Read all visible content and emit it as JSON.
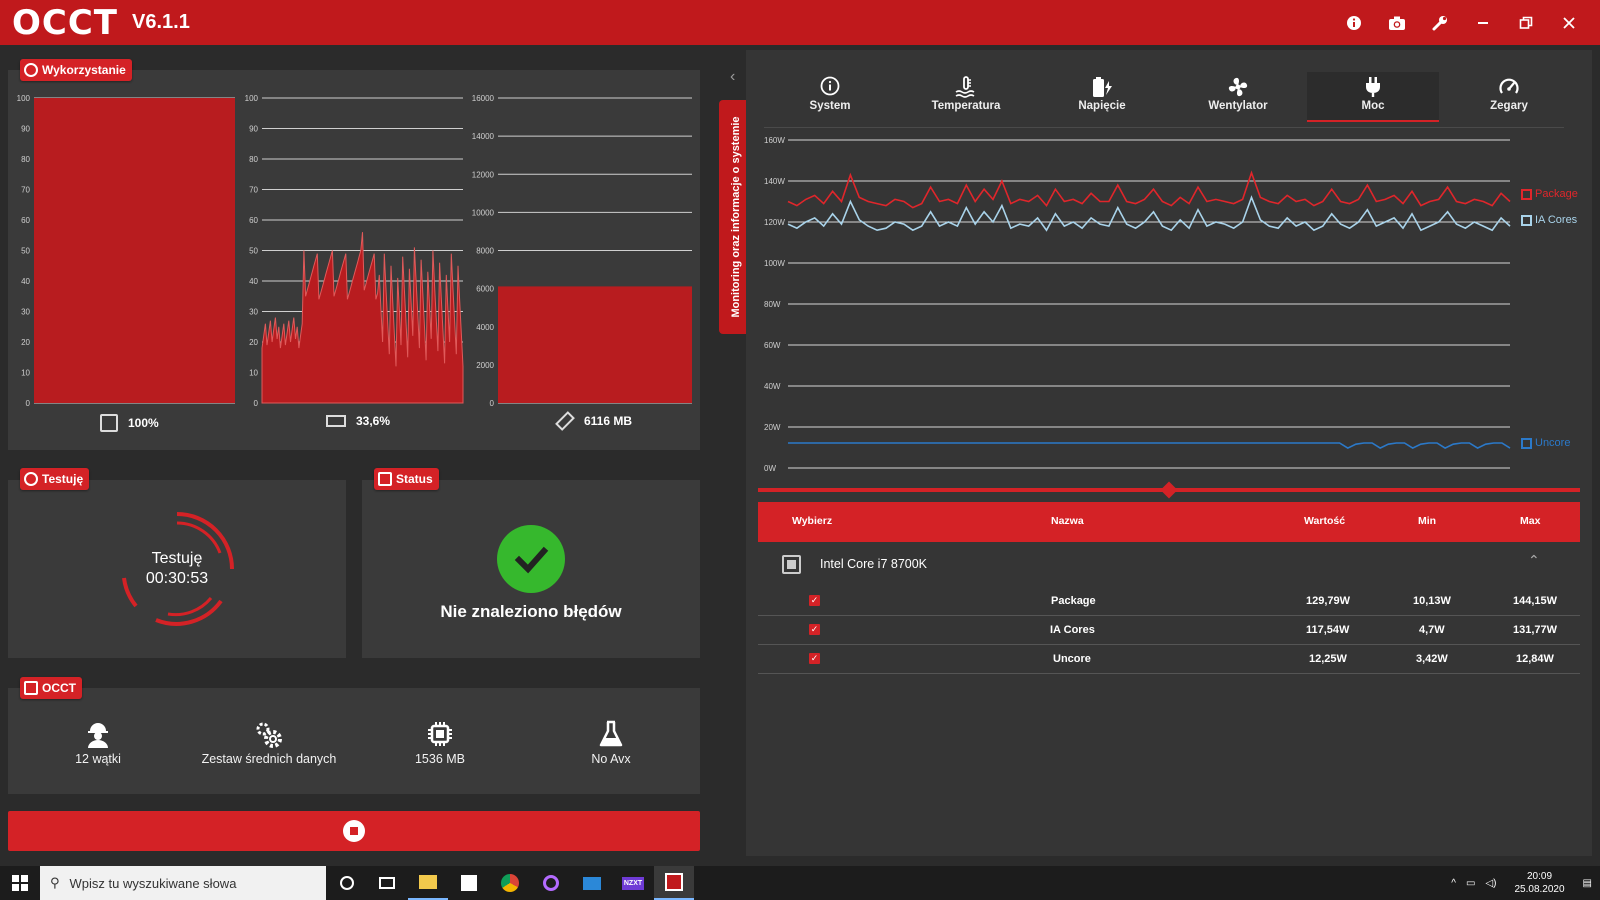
{
  "app": {
    "logo": "OCCT",
    "version": "V6.1.1",
    "title_icons": [
      "info-icon",
      "camera-icon",
      "wrench-icon",
      "minimize-icon",
      "restore-icon",
      "close-icon"
    ]
  },
  "usage": {
    "badge": "Wykorzystanie",
    "cpu_label": "100%",
    "gpu_label": "33,6%",
    "ram_label": "6116 MB",
    "cpu_axis": [
      "100",
      "90",
      "80",
      "70",
      "60",
      "50",
      "40",
      "30",
      "20",
      "10",
      "0"
    ],
    "gpu_axis": [
      "100",
      "90",
      "80",
      "70",
      "60",
      "50",
      "40",
      "30",
      "20",
      "10",
      "0"
    ],
    "ram_axis": [
      "16000",
      "14000",
      "12000",
      "10000",
      "8000",
      "6000",
      "4000",
      "2000",
      "0"
    ]
  },
  "testing": {
    "badge": "Testuję",
    "state": "Testuję",
    "elapsed": "00:30:53"
  },
  "status": {
    "badge": "Status",
    "message": "Nie znaleziono błędów"
  },
  "occt_settings": {
    "badge": "OCCT",
    "items": [
      {
        "icon": "worker-icon",
        "label": "12 wątki"
      },
      {
        "icon": "gears-icon",
        "label": "Zestaw średnich danych"
      },
      {
        "icon": "chip-icon",
        "label": "1536 MB"
      },
      {
        "icon": "flask-icon",
        "label": "No Avx"
      }
    ]
  },
  "side_tab": {
    "label": "Monitoring oraz informacje o systemie"
  },
  "tabs": [
    {
      "label": "System",
      "icon": "info-icon"
    },
    {
      "label": "Temperatura",
      "icon": "thermometer-icon"
    },
    {
      "label": "Napięcie",
      "icon": "battery-bolt-icon"
    },
    {
      "label": "Wentylator",
      "icon": "fan-icon"
    },
    {
      "label": "Moc",
      "icon": "plug-icon",
      "active": true
    },
    {
      "label": "Zegary",
      "icon": "gauge-icon"
    }
  ],
  "chart_data": {
    "type": "line",
    "y_ticks": [
      "160W",
      "140W",
      "120W",
      "100W",
      "80W",
      "60W",
      "40W",
      "20W",
      "0W"
    ],
    "ylim": [
      0,
      160
    ],
    "grid": true,
    "legend_position": "right",
    "series": [
      {
        "name": "Package",
        "color": "#e0262b",
        "values": [
          130,
          128,
          131,
          133,
          129,
          135,
          130,
          143,
          132,
          130,
          129,
          128,
          131,
          130,
          127,
          129,
          137,
          130,
          131,
          129,
          138,
          130,
          136,
          131,
          140,
          129,
          131,
          130,
          133,
          128,
          136,
          130,
          131,
          129,
          134,
          130,
          130,
          138,
          130,
          129,
          131,
          136,
          130,
          128,
          132,
          129,
          137,
          130,
          131,
          130,
          129,
          131,
          144,
          132,
          130,
          129,
          133,
          130,
          131,
          128,
          130,
          136,
          130,
          129,
          131,
          138,
          130,
          131,
          133,
          129,
          135,
          128,
          130,
          131,
          137,
          130,
          129,
          131,
          130,
          128,
          134,
          130
        ]
      },
      {
        "name": "IA Cores",
        "color": "#a9d3ea",
        "values": [
          119,
          117,
          120,
          122,
          118,
          124,
          119,
          130,
          121,
          118,
          116,
          117,
          120,
          119,
          116,
          118,
          125,
          118,
          120,
          118,
          127,
          119,
          125,
          120,
          128,
          117,
          119,
          118,
          122,
          116,
          124,
          118,
          120,
          117,
          122,
          119,
          118,
          127,
          119,
          117,
          120,
          125,
          118,
          116,
          121,
          117,
          126,
          118,
          120,
          119,
          117,
          120,
          132,
          121,
          118,
          117,
          122,
          118,
          120,
          116,
          118,
          124,
          119,
          117,
          120,
          126,
          118,
          120,
          122,
          117,
          124,
          116,
          118,
          120,
          125,
          119,
          117,
          120,
          118,
          116,
          122,
          118
        ]
      },
      {
        "name": "Uncore",
        "color": "#2b79c9",
        "values": [
          12.2,
          12.2,
          12.2,
          12.2,
          12.2,
          12.2,
          12.2,
          12.2,
          12.2,
          12.2,
          12.2,
          12.2,
          12.2,
          12.2,
          12.2,
          12.2,
          12.2,
          12.2,
          12.2,
          12.2,
          12.2,
          12.2,
          12.2,
          12.2,
          12.2,
          12.2,
          12.2,
          12.2,
          12.2,
          12.2,
          12.2,
          12.2,
          12.2,
          12.2,
          12.2,
          12.2,
          12.2,
          12.2,
          12.2,
          12.2,
          12.2,
          12.2,
          12.2,
          12.2,
          12.2,
          12.2,
          12.2,
          12.2,
          12.2,
          12.2,
          12.2,
          12.2,
          12.2,
          12.2,
          12.2,
          12.2,
          12.2,
          12.2,
          12.2,
          12.2,
          12.2,
          12.2,
          12.2,
          12.2,
          12.2,
          12.2,
          12.2,
          12.2,
          12.2,
          12.2,
          12.2,
          12.2,
          12.2,
          12.2,
          12.2,
          12.2,
          12.2,
          12.2,
          12.2,
          12.2,
          12.2,
          12.2,
          12.2,
          12.2,
          12.2,
          12.2,
          12.2,
          12.2,
          12.2,
          12.2
        ]
      }
    ]
  },
  "table": {
    "headers": {
      "select": "Wybierz",
      "name": "Nazwa",
      "value": "Wartość",
      "min": "Min",
      "max": "Max"
    },
    "group": "Intel Core i7 8700K",
    "rows": [
      {
        "name": "Package",
        "value": "129,79W",
        "min": "10,13W",
        "max": "144,15W"
      },
      {
        "name": "IA Cores",
        "value": "117,54W",
        "min": "4,7W",
        "max": "131,77W"
      },
      {
        "name": "Uncore",
        "value": "12,25W",
        "min": "3,42W",
        "max": "12,84W"
      }
    ]
  },
  "taskbar": {
    "search_placeholder": "Wpisz tu wyszukiwane słowa",
    "time": "20:09",
    "date": "25.08.2020",
    "app_label": "NZXT"
  }
}
